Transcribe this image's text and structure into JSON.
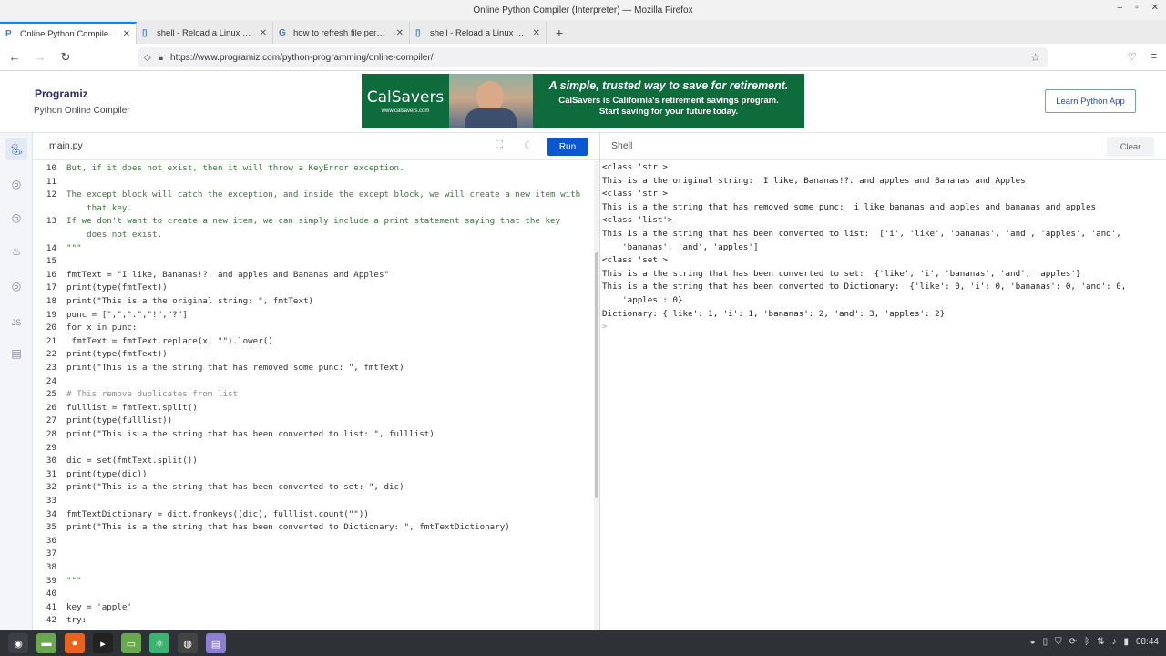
{
  "window": {
    "title": "Online Python Compiler (Interpreter) — Mozilla Firefox"
  },
  "tabs": [
    {
      "label": "Online Python Compiler (Int",
      "icon": "programiz-icon"
    },
    {
      "label": "shell - Reload a Linux user's",
      "icon": "stackexchange-icon"
    },
    {
      "label": "how to refresh file permissi",
      "icon": "google-icon"
    },
    {
      "label": "shell - Reload a Linux user's",
      "icon": "stackexchange-icon"
    }
  ],
  "nav": {
    "url": "https://www.programiz.com/python-programming/online-compiler/"
  },
  "site": {
    "logo": "Programiz",
    "subtitle": "Python Online Compiler",
    "learn_button": "Learn Python App"
  },
  "ad": {
    "brand": "CalSavers",
    "brand_url": "www.calsavers.com",
    "headline": "A simple, trusted way to save for retirement.",
    "sub1": "CalSavers is California's retirement savings program.",
    "sub2": "Start saving for your future today.",
    "background": "#0e6b3c"
  },
  "editor": {
    "file_name": "main.py",
    "run_label": "Run",
    "lines": [
      {
        "n": "10",
        "t": "But, if it does not exist, then it will throw a KeyError exception.",
        "k": "doc"
      },
      {
        "n": "11",
        "t": "",
        "k": ""
      },
      {
        "n": "12",
        "t": "The except block will catch the exception, and inside the except block, we will create a new item with",
        "k": "doc"
      },
      {
        "n": "",
        "t": "    that key.",
        "k": "doc"
      },
      {
        "n": "13",
        "t": "If we don't want to create a new item, we can simply include a print statement saying that the key",
        "k": "doc"
      },
      {
        "n": "",
        "t": "    does not exist.",
        "k": "doc"
      },
      {
        "n": "14",
        "t": "\"\"\"",
        "k": "doc"
      },
      {
        "n": "15",
        "t": "",
        "k": ""
      },
      {
        "n": "16",
        "t": "fmtText = \"I like, Bananas!?. and apples and Bananas and Apples\"",
        "k": ""
      },
      {
        "n": "17",
        "t": "print(type(fmtText))",
        "k": ""
      },
      {
        "n": "18",
        "t": "print(\"This is a the original string: \", fmtText)",
        "k": ""
      },
      {
        "n": "19",
        "t": "punc = [\",\",\".\",\"!\",\"?\"]",
        "k": ""
      },
      {
        "n": "20",
        "t": "for x in punc:",
        "k": ""
      },
      {
        "n": "21",
        "t": " fmtText = fmtText.replace(x, \"\").lower()",
        "k": ""
      },
      {
        "n": "22",
        "t": "print(type(fmtText))",
        "k": ""
      },
      {
        "n": "23",
        "t": "print(\"This is a the string that has removed some punc: \", fmtText)",
        "k": ""
      },
      {
        "n": "24",
        "t": "",
        "k": ""
      },
      {
        "n": "25",
        "t": "# This remove duplicates from list",
        "k": "cmt"
      },
      {
        "n": "26",
        "t": "fulllist = fmtText.split()",
        "k": ""
      },
      {
        "n": "27",
        "t": "print(type(fulllist))",
        "k": ""
      },
      {
        "n": "28",
        "t": "print(\"This is a the string that has been converted to list: \", fulllist)",
        "k": ""
      },
      {
        "n": "29",
        "t": "",
        "k": ""
      },
      {
        "n": "30",
        "t": "dic = set(fmtText.split())",
        "k": ""
      },
      {
        "n": "31",
        "t": "print(type(dic))",
        "k": ""
      },
      {
        "n": "32",
        "t": "print(\"This is a the string that has been converted to set: \", dic)",
        "k": ""
      },
      {
        "n": "33",
        "t": "",
        "k": ""
      },
      {
        "n": "34",
        "t": "fmtTextDictionary = dict.fromkeys((dic), fulllist.count(\"\"))",
        "k": ""
      },
      {
        "n": "35",
        "t": "print(\"This is a the string that has been converted to Dictionary: \", fmtTextDictionary)",
        "k": ""
      },
      {
        "n": "36",
        "t": "",
        "k": ""
      },
      {
        "n": "37",
        "t": "",
        "k": ""
      },
      {
        "n": "38",
        "t": "",
        "k": ""
      },
      {
        "n": "39",
        "t": "\"\"\"",
        "k": "doc"
      },
      {
        "n": "40",
        "t": "",
        "k": ""
      },
      {
        "n": "41",
        "t": "key = 'apple'",
        "k": ""
      },
      {
        "n": "42",
        "t": "try:",
        "k": ""
      }
    ]
  },
  "shell": {
    "title": "Shell",
    "clear_label": "Clear",
    "lines": [
      "<class 'str'>",
      "This is a the original string:  I like, Bananas!?. and apples and Bananas and Apples",
      "<class 'str'>",
      "This is a the string that has removed some punc:  i like bananas and apples and bananas and apples",
      "<class 'list'>",
      "This is a the string that has been converted to list:  ['i', 'like', 'bananas', 'and', 'apples', 'and',",
      "    'bananas', 'and', 'apples']",
      "<class 'set'>",
      "This is a the string that has been converted to set:  {'like', 'i', 'bananas', 'and', 'apples'}",
      "This is a the string that has been converted to Dictionary:  {'like': 0, 'i': 0, 'bananas': 0, 'and': 0,",
      "    'apples': 0}",
      "Dictionary: {'like': 1, 'i': 1, 'bananas': 2, 'and': 3, 'apples': 2}"
    ],
    "prompt": ">"
  },
  "taskbar": {
    "clock": "08:44"
  },
  "colors": {
    "accent": "#0b57d0",
    "docstring": "#3c763d",
    "taskbar": "#2e3136"
  }
}
